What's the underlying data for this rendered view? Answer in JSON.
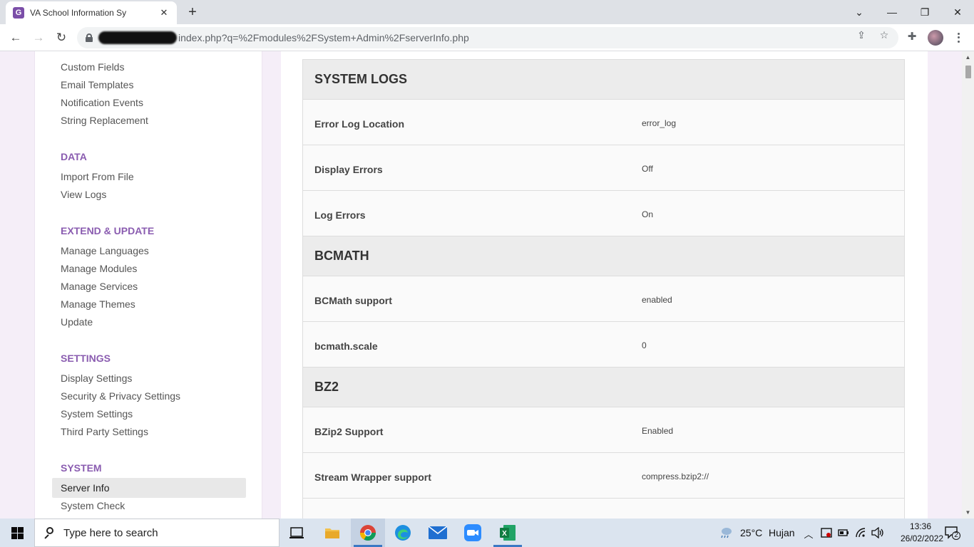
{
  "browser": {
    "tab_favicon_letter": "G",
    "tab_title": "VA School Information Sy",
    "url": "index.php?q=%2Fmodules%2FSystem+Admin%2FserverInfo.php"
  },
  "sidebar": {
    "top_items": [
      "Custom Fields",
      "Email Templates",
      "Notification Events",
      "String Replacement"
    ],
    "data_heading": "DATA",
    "data_items": [
      "Import From File",
      "View Logs"
    ],
    "extend_heading": "EXTEND & UPDATE",
    "extend_items": [
      "Manage Languages",
      "Manage Modules",
      "Manage Services",
      "Manage Themes",
      "Update"
    ],
    "settings_heading": "SETTINGS",
    "settings_items": [
      "Display Settings",
      "Security & Privacy Settings",
      "System Settings",
      "Third Party Settings"
    ],
    "system_heading": "SYSTEM",
    "system_items": [
      "Server Info",
      "System Check"
    ]
  },
  "server_info": {
    "system_logs": {
      "title": "SYSTEM LOGS",
      "rows": [
        {
          "key": "Error Log Location",
          "value": "error_log"
        },
        {
          "key": "Display Errors",
          "value": "Off"
        },
        {
          "key": "Log Errors",
          "value": "On"
        }
      ]
    },
    "bcmath": {
      "title": "BCMATH",
      "rows": [
        {
          "key": "BCMath support",
          "value": "enabled"
        },
        {
          "key": "bcmath.scale",
          "value": "0"
        }
      ]
    },
    "bz2": {
      "title": "BZ2",
      "rows": [
        {
          "key": "BZip2 Support",
          "value": "Enabled"
        },
        {
          "key": "Stream Wrapper support",
          "value": "compress.bzip2://"
        }
      ]
    }
  },
  "taskbar": {
    "search_placeholder": "Type here to search",
    "weather_temp": "25°C",
    "weather_text": "Hujan",
    "time": "13:36",
    "date": "26/02/2022",
    "notification_count": "2"
  },
  "colors": {
    "accent_purple": "#8a5cb0",
    "page_bg": "#f5eef8",
    "section_bg": "#ececec"
  }
}
